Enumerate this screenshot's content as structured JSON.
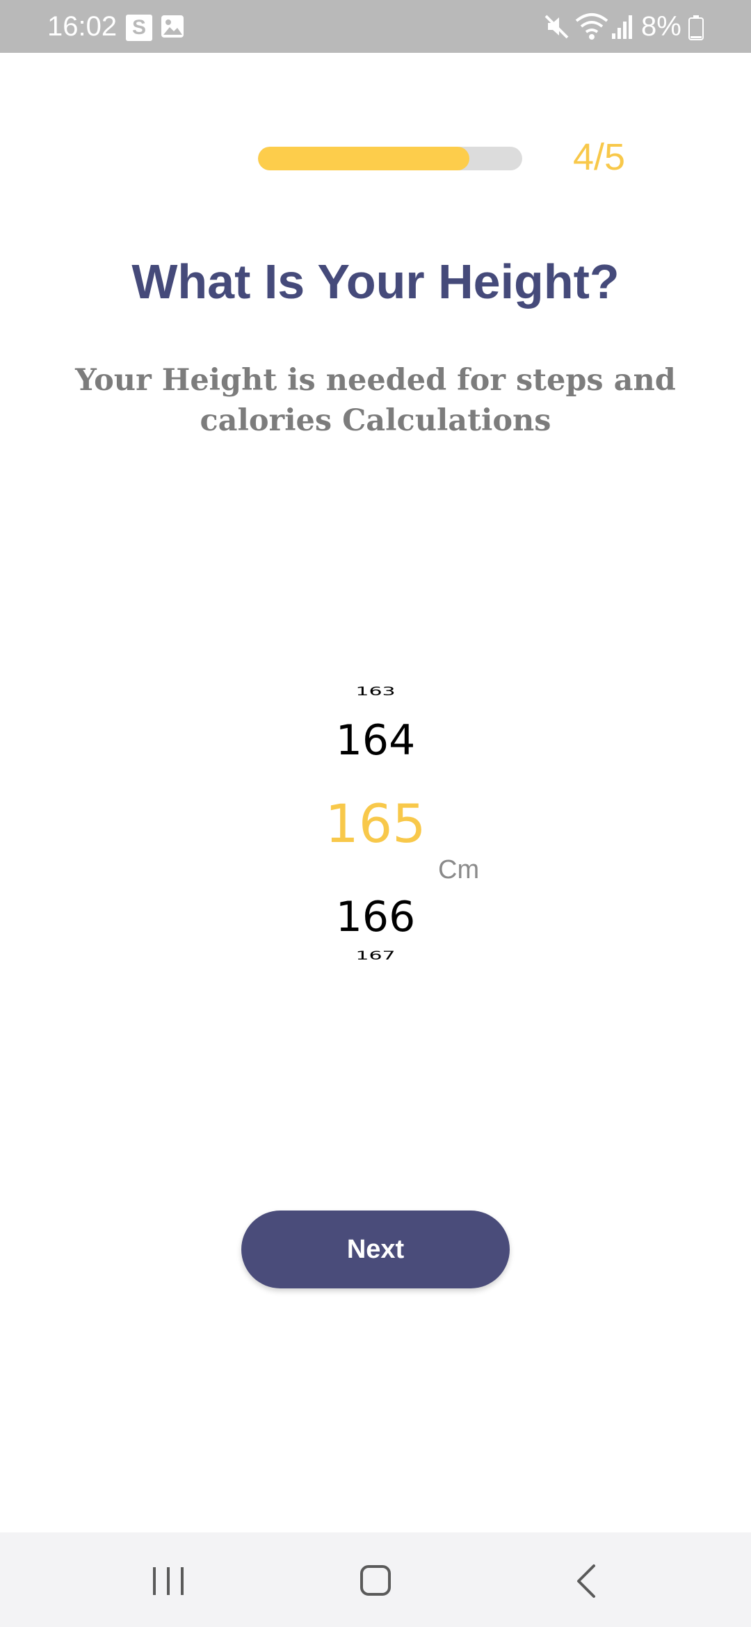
{
  "status_bar": {
    "time": "16:02",
    "s_icon_label": "S",
    "battery": "8%",
    "icons": [
      "s-icon",
      "gallery-icon",
      "mute-icon",
      "wifi-icon",
      "signal-icon",
      "battery-icon"
    ]
  },
  "progress": {
    "label": "4/5",
    "fraction": 0.8,
    "fill_color": "#fdcd4b",
    "track_color": "#dcdcdc"
  },
  "header": {
    "title": "What Is Your Height?",
    "subtitle": "Your Height is needed for steps and calories Calculations"
  },
  "picker": {
    "items": [
      "163",
      "164",
      "165",
      "166",
      "167"
    ],
    "selected": "165",
    "unit": "Cm",
    "selected_color": "#f8c84a"
  },
  "actions": {
    "next_label": "Next",
    "button_color": "#4a4c7a"
  },
  "nav_bar": {
    "icons": [
      "recents-icon",
      "home-icon",
      "back-icon"
    ]
  },
  "colors": {
    "title": "#454a7a",
    "subtitle": "#7c7c7c",
    "status_bar": "#b9b9b9"
  }
}
